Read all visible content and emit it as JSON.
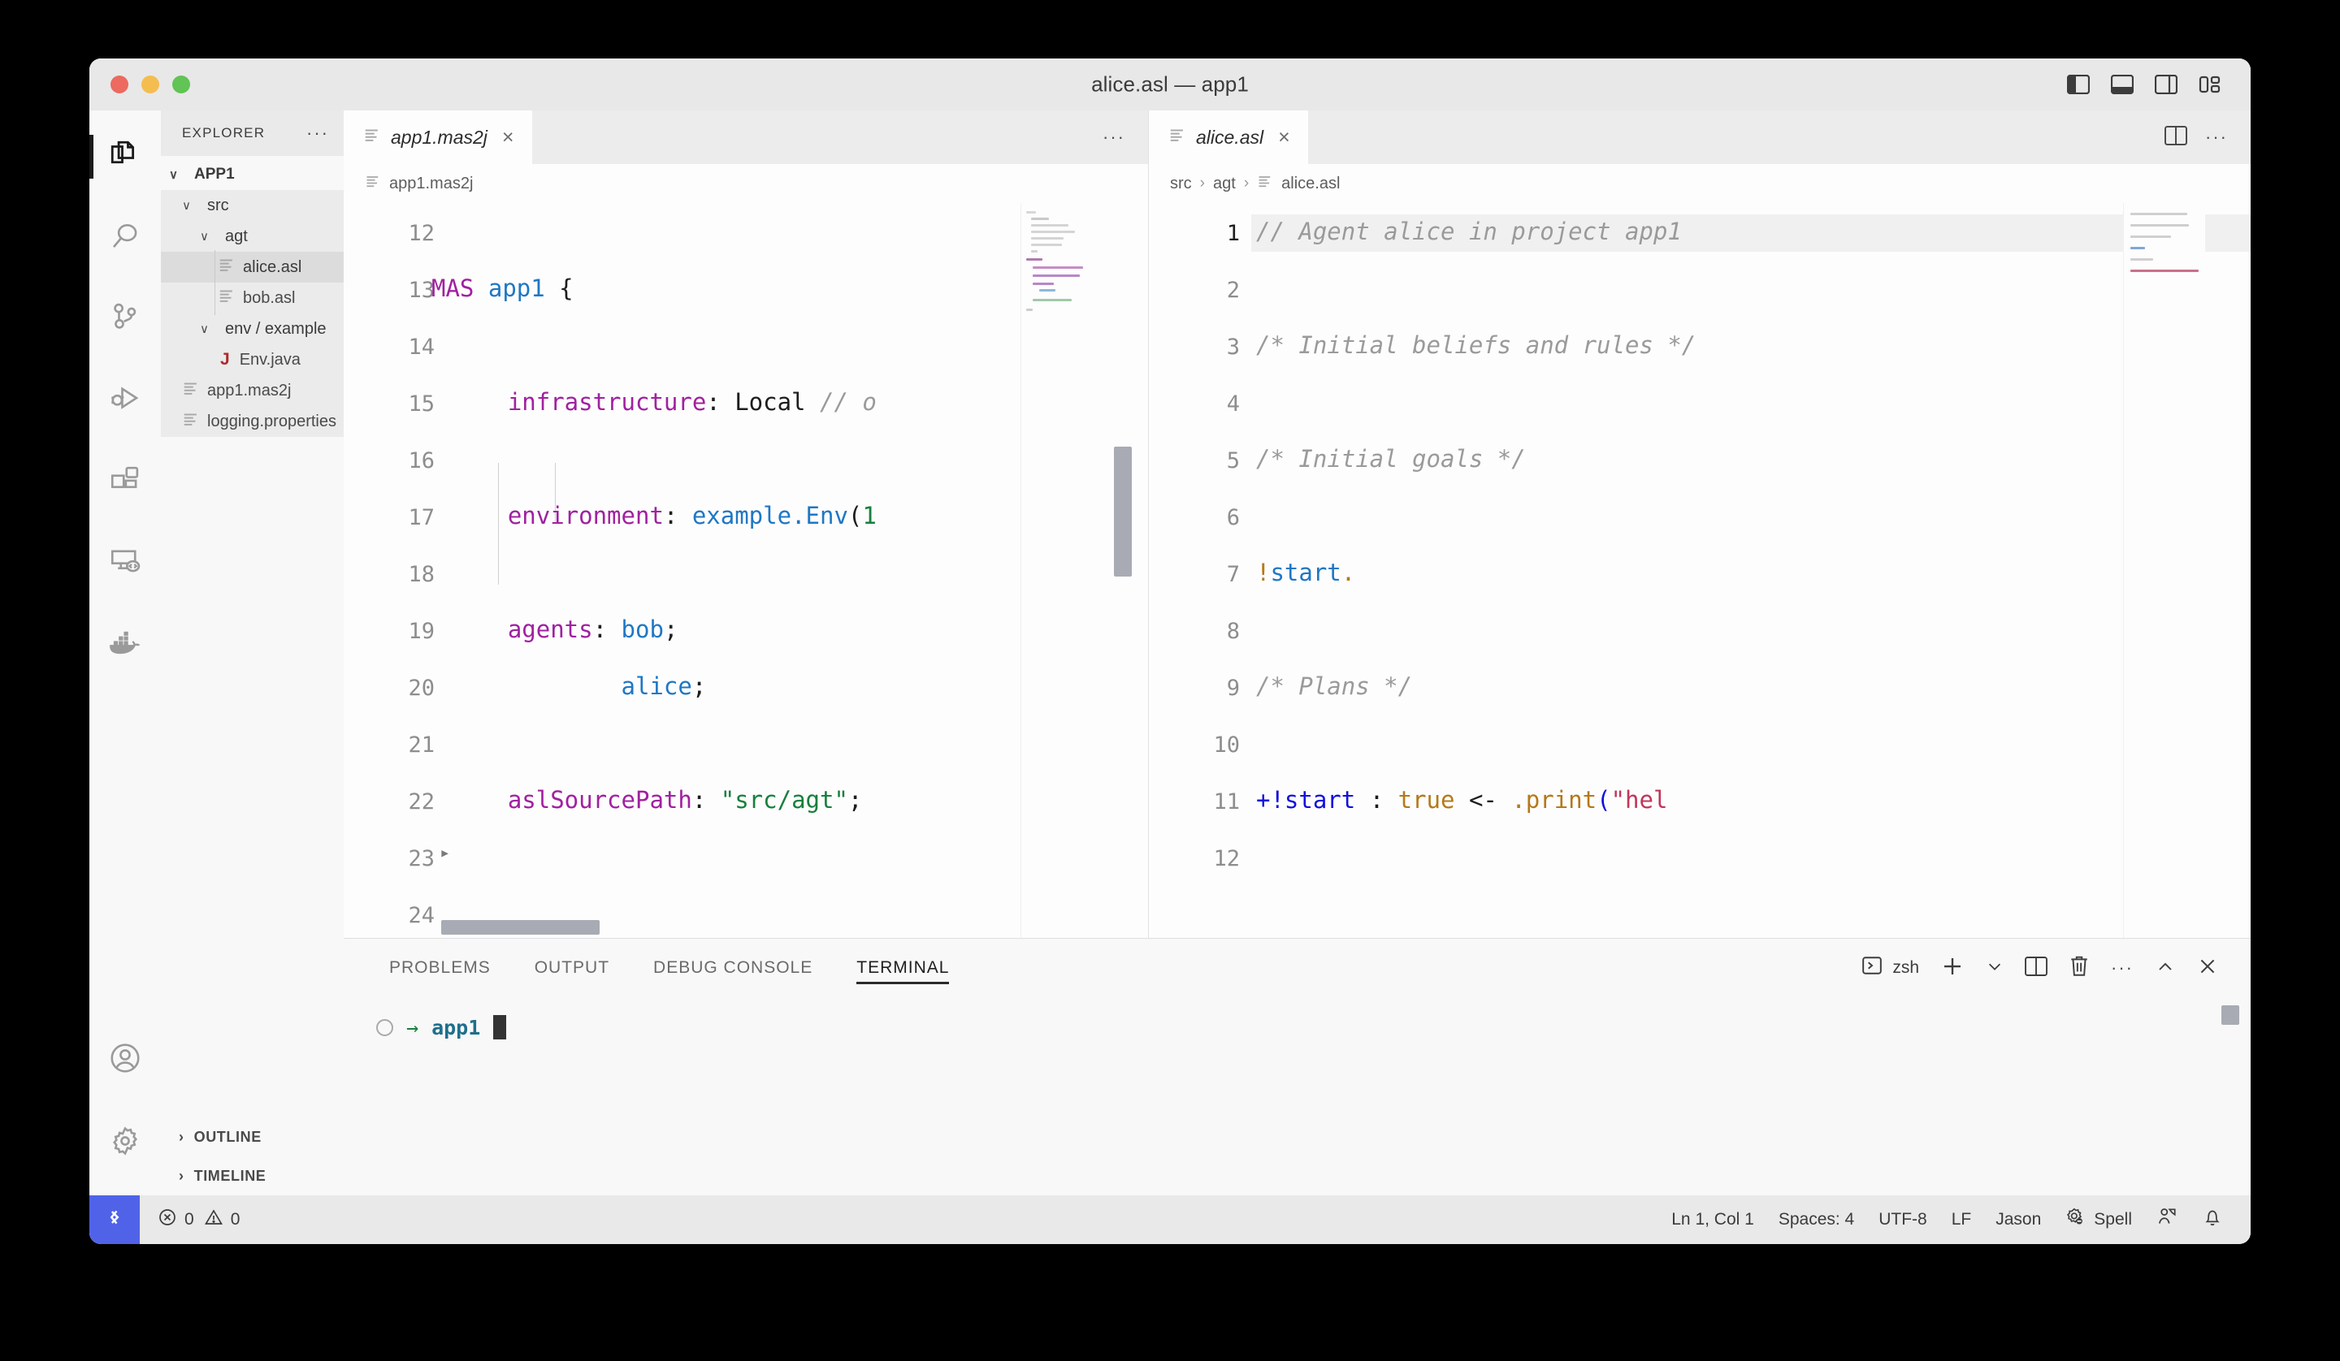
{
  "window": {
    "title": "alice.asl — app1",
    "traffic_lights": [
      "close",
      "minimize",
      "zoom"
    ],
    "layout_buttons": [
      {
        "name": "toggle-primary-sidebar",
        "state": "on"
      },
      {
        "name": "toggle-panel",
        "state": "on"
      },
      {
        "name": "toggle-secondary-sidebar",
        "state": "off"
      },
      {
        "name": "customize-layout",
        "state": "off"
      }
    ]
  },
  "activity_bar": {
    "items": [
      {
        "name": "explorer",
        "icon": "files-icon",
        "active": true
      },
      {
        "name": "search",
        "icon": "search-icon",
        "active": false
      },
      {
        "name": "source-control",
        "icon": "source-control-icon",
        "active": false
      },
      {
        "name": "run-and-debug",
        "icon": "run-debug-icon",
        "active": false
      },
      {
        "name": "extensions",
        "icon": "extensions-icon",
        "active": false
      },
      {
        "name": "remote-explorer",
        "icon": "remote-explorer-icon",
        "active": false
      },
      {
        "name": "docker",
        "icon": "docker-icon",
        "active": false
      }
    ],
    "bottom": [
      {
        "name": "accounts",
        "icon": "account-icon"
      },
      {
        "name": "manage",
        "icon": "gear-icon"
      }
    ]
  },
  "sidebar": {
    "header": "EXPLORER",
    "more_actions": "···",
    "root": {
      "label": "APP1",
      "chevron": "∨"
    },
    "tree": [
      {
        "label": "src",
        "type": "folder",
        "depth": 1,
        "chevron": "∨",
        "selected": false
      },
      {
        "label": "agt",
        "type": "folder",
        "depth": 2,
        "chevron": "∨",
        "selected": false
      },
      {
        "label": "alice.asl",
        "type": "file",
        "depth": 3,
        "icon": "text-file-icon",
        "selected": true
      },
      {
        "label": "bob.asl",
        "type": "file",
        "depth": 3,
        "icon": "text-file-icon",
        "selected": false
      },
      {
        "label": "env / example",
        "type": "folder",
        "depth": 2,
        "chevron": "∨",
        "selected": false
      },
      {
        "label": "Env.java",
        "type": "file",
        "depth": 3,
        "icon": "java-file-icon",
        "selected": false
      },
      {
        "label": "app1.mas2j",
        "type": "file",
        "depth": 1,
        "icon": "text-file-icon",
        "selected": false
      },
      {
        "label": "logging.properties",
        "type": "file",
        "depth": 1,
        "icon": "text-file-icon",
        "selected": false
      }
    ],
    "sections": [
      {
        "label": "OUTLINE",
        "chevron": "›"
      },
      {
        "label": "TIMELINE",
        "chevron": "›"
      }
    ]
  },
  "editor_groups": [
    {
      "name": "left",
      "tab": {
        "label": "app1.mas2j",
        "icon": "text-file-icon",
        "close": "×",
        "preview_italic": true
      },
      "tabbar_actions": [
        "more-actions"
      ],
      "breadcrumb": [
        "app1.mas2j"
      ],
      "first_visible_line": 12,
      "lines": [
        {
          "n": 12,
          "text": ""
        },
        {
          "n": 13,
          "text": "MAS app1 {"
        },
        {
          "n": 14,
          "text": ""
        },
        {
          "n": 15,
          "text": "    infrastructure: Local // other"
        },
        {
          "n": 16,
          "text": ""
        },
        {
          "n": 17,
          "text": "    environment: example.Env(1"
        },
        {
          "n": 18,
          "text": ""
        },
        {
          "n": 19,
          "text": "    agents: bob;"
        },
        {
          "n": 20,
          "text": "            alice;"
        },
        {
          "n": 21,
          "text": ""
        },
        {
          "n": 22,
          "text": "    aslSourcePath: \"src/agt\";"
        },
        {
          "n": 23,
          "text": ""
        },
        {
          "n": 24,
          "text": ""
        }
      ],
      "horizontally_scrolled": true
    },
    {
      "name": "right",
      "tab": {
        "label": "alice.asl",
        "icon": "text-file-icon",
        "close": "×",
        "preview_italic": true
      },
      "tabbar_actions": [
        "split-editor-right",
        "more-actions"
      ],
      "breadcrumb": [
        "src",
        "agt",
        "alice.asl"
      ],
      "first_visible_line": 1,
      "active_line": 1,
      "lines": [
        {
          "n": 1,
          "text": "// Agent alice in project app1"
        },
        {
          "n": 2,
          "text": ""
        },
        {
          "n": 3,
          "text": "/* Initial beliefs and rules */"
        },
        {
          "n": 4,
          "text": ""
        },
        {
          "n": 5,
          "text": "/* Initial goals */"
        },
        {
          "n": 6,
          "text": ""
        },
        {
          "n": 7,
          "text": "!start."
        },
        {
          "n": 8,
          "text": ""
        },
        {
          "n": 9,
          "text": "/* Plans */"
        },
        {
          "n": 10,
          "text": ""
        },
        {
          "n": 11,
          "text": "+!start : true <- .print(\"hello world.\")."
        },
        {
          "n": 12,
          "text": ""
        }
      ]
    }
  ],
  "panel": {
    "tabs": [
      {
        "label": "PROBLEMS",
        "active": false
      },
      {
        "label": "OUTPUT",
        "active": false
      },
      {
        "label": "DEBUG CONSOLE",
        "active": false
      },
      {
        "label": "TERMINAL",
        "active": true
      }
    ],
    "shell": {
      "icon": "terminal-icon",
      "label": "zsh"
    },
    "actions": [
      {
        "name": "new-terminal",
        "icon": "plus-icon"
      },
      {
        "name": "terminal-dropdown",
        "icon": "chevron-down-icon"
      },
      {
        "name": "split-terminal",
        "icon": "split-icon"
      },
      {
        "name": "kill-terminal",
        "icon": "trash-icon"
      },
      {
        "name": "terminal-more",
        "icon": "ellipsis-icon"
      },
      {
        "name": "maximize-panel",
        "icon": "chevron-up-icon"
      },
      {
        "name": "close-panel",
        "icon": "close-icon"
      }
    ],
    "terminal": {
      "prompt_symbol": "→",
      "cwd": "app1",
      "cursor": true
    }
  },
  "status_bar": {
    "remote_icon": "remote-indicator-icon",
    "errors": {
      "icon": "error-icon",
      "count": "0"
    },
    "warnings": {
      "icon": "warning-icon",
      "count": "0"
    },
    "right_items": [
      {
        "name": "cursor-position",
        "label": "Ln 1, Col 1"
      },
      {
        "name": "indentation",
        "label": "Spaces: 4"
      },
      {
        "name": "encoding",
        "label": "UTF-8"
      },
      {
        "name": "eol",
        "label": "LF"
      },
      {
        "name": "language-mode",
        "label": "Jason"
      },
      {
        "name": "spell-checker",
        "label": "Spell",
        "icon": "spell-icon"
      },
      {
        "name": "live-share",
        "icon": "live-share-icon"
      },
      {
        "name": "notifications",
        "icon": "bell-icon"
      }
    ]
  },
  "colors": {
    "accent_blue": "#5063e8",
    "keyword_purple": "#a021a0",
    "identifier_blue": "#1f77c4",
    "string_green": "#17803d",
    "comment_gray": "#9a9a9a",
    "atom_orange": "#b5791a",
    "event_blue": "#1111dd",
    "java_red": "#b02a2a"
  }
}
